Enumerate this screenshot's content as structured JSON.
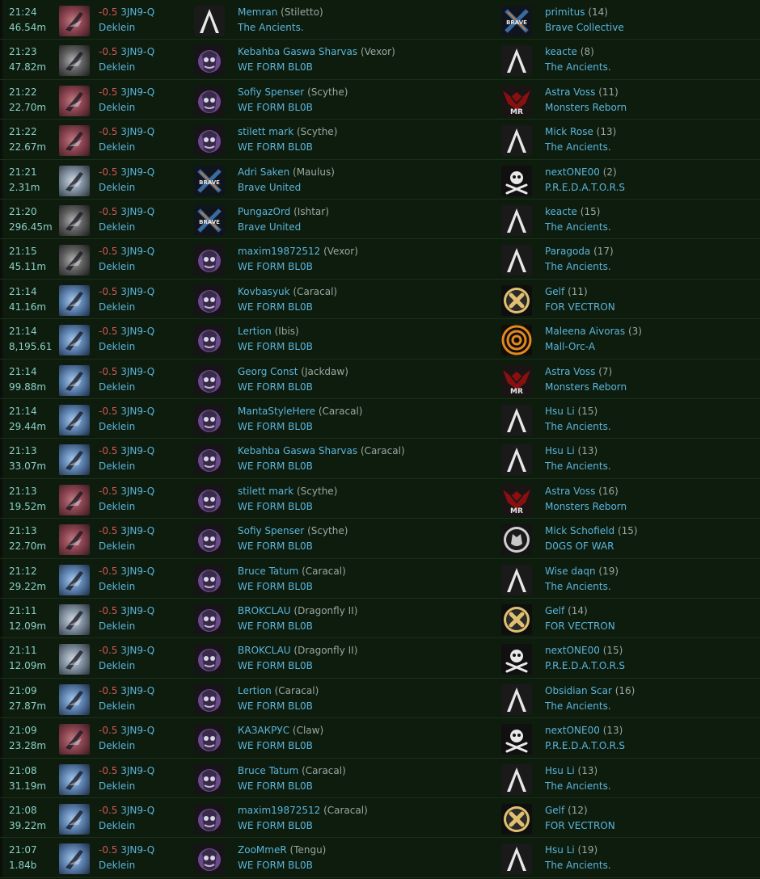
{
  "kills": [
    {
      "time": "21:24",
      "value": "46.54m",
      "ship_icon": "red",
      "sec": "-0.5",
      "system": "3JN9-Q",
      "region": "Deklein",
      "victim": {
        "logo": "ancients",
        "pilot": "Memran",
        "ship": "(Stiletto)",
        "corp": "The Ancients."
      },
      "attacker": {
        "logo": "brave",
        "pilot": "primitus",
        "count": "(14)",
        "corp": "Brave Collective"
      }
    },
    {
      "time": "21:23",
      "value": "47.82m",
      "ship_icon": "dark",
      "sec": "-0.5",
      "system": "3JN9-Q",
      "region": "Deklein",
      "victim": {
        "logo": "blob",
        "pilot": "Kebahba Gaswa Sharvas",
        "ship": "(Vexor)",
        "corp": "WE FORM BL0B"
      },
      "attacker": {
        "logo": "ancients",
        "pilot": "keacte",
        "count": "(8)",
        "corp": "The Ancients."
      }
    },
    {
      "time": "21:22",
      "value": "22.70m",
      "ship_icon": "red",
      "sec": "-0.5",
      "system": "3JN9-Q",
      "region": "Deklein",
      "victim": {
        "logo": "blob",
        "pilot": "Sofiy Spenser",
        "ship": "(Scythe)",
        "corp": "WE FORM BL0B"
      },
      "attacker": {
        "logo": "mr",
        "pilot": "Astra Voss",
        "count": "(11)",
        "corp": "Monsters Reborn"
      }
    },
    {
      "time": "21:22",
      "value": "22.67m",
      "ship_icon": "red",
      "sec": "-0.5",
      "system": "3JN9-Q",
      "region": "Deklein",
      "victim": {
        "logo": "blob",
        "pilot": "stilett mark",
        "ship": "(Scythe)",
        "corp": "WE FORM BL0B"
      },
      "attacker": {
        "logo": "ancients",
        "pilot": "Mick Rose",
        "count": "(13)",
        "corp": "The Ancients."
      }
    },
    {
      "time": "21:21",
      "value": "2.31m",
      "ship_icon": "gray",
      "sec": "-0.5",
      "system": "3JN9-Q",
      "region": "Deklein",
      "victim": {
        "logo": "brave",
        "pilot": "Adri Saken",
        "ship": "(Maulus)",
        "corp": "Brave United"
      },
      "attacker": {
        "logo": "pred",
        "pilot": "nextONE00",
        "count": "(2)",
        "corp": "P.R.E.D.A.T.O.R.S"
      }
    },
    {
      "time": "21:20",
      "value": "296.45m",
      "ship_icon": "dark",
      "sec": "-0.5",
      "system": "3JN9-Q",
      "region": "Deklein",
      "victim": {
        "logo": "brave",
        "pilot": "PungazOrd",
        "ship": "(Ishtar)",
        "corp": "Brave United"
      },
      "attacker": {
        "logo": "ancients",
        "pilot": "keacte",
        "count": "(15)",
        "corp": "The Ancients."
      }
    },
    {
      "time": "21:15",
      "value": "45.11m",
      "ship_icon": "dark",
      "sec": "-0.5",
      "system": "3JN9-Q",
      "region": "Deklein",
      "victim": {
        "logo": "blob",
        "pilot": "maxim19872512",
        "ship": "(Vexor)",
        "corp": "WE FORM BL0B"
      },
      "attacker": {
        "logo": "ancients",
        "pilot": "Paragoda",
        "count": "(17)",
        "corp": "The Ancients."
      }
    },
    {
      "time": "21:14",
      "value": "41.16m",
      "ship_icon": "blue",
      "sec": "-0.5",
      "system": "3JN9-Q",
      "region": "Deklein",
      "victim": {
        "logo": "blob",
        "pilot": "Kovbasyuk",
        "ship": "(Caracal)",
        "corp": "WE FORM BL0B"
      },
      "attacker": {
        "logo": "vectron",
        "pilot": "Gelf",
        "count": "(11)",
        "corp": "FOR VECTRON"
      }
    },
    {
      "time": "21:14",
      "value": "8,195.61",
      "ship_icon": "blue",
      "sec": "-0.5",
      "system": "3JN9-Q",
      "region": "Deklein",
      "victim": {
        "logo": "blob",
        "pilot": "Lertion",
        "ship": "(Ibis)",
        "corp": "WE FORM BL0B"
      },
      "attacker": {
        "logo": "mallorc",
        "pilot": "Maleena Aivoras",
        "count": "(3)",
        "corp": "Mall-Orc-A"
      }
    },
    {
      "time": "21:14",
      "value": "99.88m",
      "ship_icon": "blue",
      "sec": "-0.5",
      "system": "3JN9-Q",
      "region": "Deklein",
      "victim": {
        "logo": "blob",
        "pilot": "Georg Const",
        "ship": "(Jackdaw)",
        "corp": "WE FORM BL0B"
      },
      "attacker": {
        "logo": "mr",
        "pilot": "Astra Voss",
        "count": "(7)",
        "corp": "Monsters Reborn"
      }
    },
    {
      "time": "21:14",
      "value": "29.44m",
      "ship_icon": "blue",
      "sec": "-0.5",
      "system": "3JN9-Q",
      "region": "Deklein",
      "victim": {
        "logo": "blob",
        "pilot": "MantaStyleHere",
        "ship": "(Caracal)",
        "corp": "WE FORM BL0B"
      },
      "attacker": {
        "logo": "ancients",
        "pilot": "Hsu Li",
        "count": "(15)",
        "corp": "The Ancients."
      }
    },
    {
      "time": "21:13",
      "value": "33.07m",
      "ship_icon": "blue",
      "sec": "-0.5",
      "system": "3JN9-Q",
      "region": "Deklein",
      "victim": {
        "logo": "blob",
        "pilot": "Kebahba Gaswa Sharvas",
        "ship": "(Caracal)",
        "corp": "WE FORM BL0B"
      },
      "attacker": {
        "logo": "ancients",
        "pilot": "Hsu Li",
        "count": "(13)",
        "corp": "The Ancients."
      }
    },
    {
      "time": "21:13",
      "value": "19.52m",
      "ship_icon": "red",
      "sec": "-0.5",
      "system": "3JN9-Q",
      "region": "Deklein",
      "victim": {
        "logo": "blob",
        "pilot": "stilett mark",
        "ship": "(Scythe)",
        "corp": "WE FORM BL0B"
      },
      "attacker": {
        "logo": "mr",
        "pilot": "Astra Voss",
        "count": "(16)",
        "corp": "Monsters Reborn"
      }
    },
    {
      "time": "21:13",
      "value": "22.70m",
      "ship_icon": "red",
      "sec": "-0.5",
      "system": "3JN9-Q",
      "region": "Deklein",
      "victim": {
        "logo": "blob",
        "pilot": "Sofiy Spenser",
        "ship": "(Scythe)",
        "corp": "WE FORM BL0B"
      },
      "attacker": {
        "logo": "dogs",
        "pilot": "Mick Schofield",
        "count": "(15)",
        "corp": "D0GS OF WAR"
      }
    },
    {
      "time": "21:12",
      "value": "29.22m",
      "ship_icon": "blue",
      "sec": "-0.5",
      "system": "3JN9-Q",
      "region": "Deklein",
      "victim": {
        "logo": "blob",
        "pilot": "Bruce Tatum",
        "ship": "(Caracal)",
        "corp": "WE FORM BL0B"
      },
      "attacker": {
        "logo": "ancients",
        "pilot": "Wise daqn",
        "count": "(19)",
        "corp": "The Ancients."
      }
    },
    {
      "time": "21:11",
      "value": "12.09m",
      "ship_icon": "gray",
      "sec": "-0.5",
      "system": "3JN9-Q",
      "region": "Deklein",
      "victim": {
        "logo": "blob",
        "pilot": "BROKCLAU",
        "ship": "(Dragonfly II)",
        "corp": "WE FORM BL0B"
      },
      "attacker": {
        "logo": "vectron",
        "pilot": "Gelf",
        "count": "(14)",
        "corp": "FOR VECTRON"
      }
    },
    {
      "time": "21:11",
      "value": "12.09m",
      "ship_icon": "gray",
      "sec": "-0.5",
      "system": "3JN9-Q",
      "region": "Deklein",
      "victim": {
        "logo": "blob",
        "pilot": "BROKCLAU",
        "ship": "(Dragonfly II)",
        "corp": "WE FORM BL0B"
      },
      "attacker": {
        "logo": "pred",
        "pilot": "nextONE00",
        "count": "(15)",
        "corp": "P.R.E.D.A.T.O.R.S"
      }
    },
    {
      "time": "21:09",
      "value": "27.87m",
      "ship_icon": "blue",
      "sec": "-0.5",
      "system": "3JN9-Q",
      "region": "Deklein",
      "victim": {
        "logo": "blob",
        "pilot": "Lertion",
        "ship": "(Caracal)",
        "corp": "WE FORM BL0B"
      },
      "attacker": {
        "logo": "ancients",
        "pilot": "Obsidian Scar",
        "count": "(16)",
        "corp": "The Ancients."
      }
    },
    {
      "time": "21:09",
      "value": "23.28m",
      "ship_icon": "red",
      "sec": "-0.5",
      "system": "3JN9-Q",
      "region": "Deklein",
      "victim": {
        "logo": "blob",
        "pilot": "КАЗАКРУС",
        "ship": "(Claw)",
        "corp": "WE FORM BL0B"
      },
      "attacker": {
        "logo": "pred",
        "pilot": "nextONE00",
        "count": "(13)",
        "corp": "P.R.E.D.A.T.O.R.S"
      }
    },
    {
      "time": "21:08",
      "value": "31.19m",
      "ship_icon": "blue",
      "sec": "-0.5",
      "system": "3JN9-Q",
      "region": "Deklein",
      "victim": {
        "logo": "blob",
        "pilot": "Bruce Tatum",
        "ship": "(Caracal)",
        "corp": "WE FORM BL0B"
      },
      "attacker": {
        "logo": "ancients",
        "pilot": "Hsu Li",
        "count": "(13)",
        "corp": "The Ancients."
      }
    },
    {
      "time": "21:08",
      "value": "39.22m",
      "ship_icon": "blue",
      "sec": "-0.5",
      "system": "3JN9-Q",
      "region": "Deklein",
      "victim": {
        "logo": "blob",
        "pilot": "maxim19872512",
        "ship": "(Caracal)",
        "corp": "WE FORM BL0B"
      },
      "attacker": {
        "logo": "vectron",
        "pilot": "Gelf",
        "count": "(12)",
        "corp": "FOR VECTRON"
      }
    },
    {
      "time": "21:07",
      "value": "1.84b",
      "ship_icon": "blue",
      "sec": "-0.5",
      "system": "3JN9-Q",
      "region": "Deklein",
      "victim": {
        "logo": "blob",
        "pilot": "ZooMmeR",
        "ship": "(Tengu)",
        "corp": "WE FORM BL0B"
      },
      "attacker": {
        "logo": "ancients",
        "pilot": "Hsu Li",
        "count": "(19)",
        "corp": "The Ancients."
      }
    }
  ],
  "logo_text": {
    "brave": "BRAVE",
    "mr": "MR"
  }
}
